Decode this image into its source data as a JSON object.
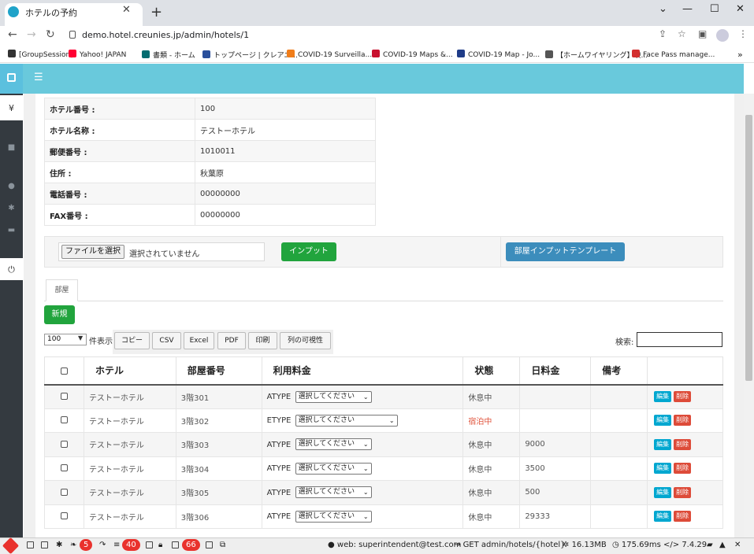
{
  "browser": {
    "tab_title": "ホテルの予約",
    "url": "demo.hotel.creunies.jp/admin/hotels/1",
    "bookmarks": [
      {
        "label": "[GroupSession]",
        "color": "#333333"
      },
      {
        "label": "Yahoo! JAPAN",
        "color": "#ff0033"
      },
      {
        "label": "書類 - ホーム",
        "color": "#036c70"
      },
      {
        "label": "トップページ | クレアニ...",
        "color": "#2a4f9b"
      },
      {
        "label": "COVID-19 Surveilla...",
        "color": "#f07d1a"
      },
      {
        "label": "COVID-19 Maps &...",
        "color": "#c8102e"
      },
      {
        "label": "COVID-19 Map - Jo...",
        "color": "#1f3c88"
      },
      {
        "label": "【ホームワイヤリング】映...",
        "color": "#555555"
      },
      {
        "label": "Face Pass manage...",
        "color": "#d32f2f"
      }
    ]
  },
  "hotel_info": [
    {
      "label": "ホテル番号 :",
      "value": "100"
    },
    {
      "label": "ホテル名称 :",
      "value": "テストーホテル"
    },
    {
      "label": "郵便番号 :",
      "value": "1010011"
    },
    {
      "label": "住所 :",
      "value": "秋葉原"
    },
    {
      "label": "電話番号 :",
      "value": "00000000"
    },
    {
      "label": "FAX番号 :",
      "value": "00000000"
    }
  ],
  "upload": {
    "file_button": "ファイルを選択",
    "file_status": "選択されていません",
    "input_button": "インプット",
    "template_button": "部屋インプットテンプレート"
  },
  "tabs": {
    "room": "部屋"
  },
  "new_button": "新規",
  "datatable": {
    "length_value": "100",
    "length_label": "件表示",
    "buttons": [
      "コピー",
      "CSV",
      "Excel",
      "PDF",
      "印刷",
      "列の可視性"
    ],
    "search_label": "検索:",
    "columns": [
      "ホテル",
      "部屋番号",
      "利用料金",
      "状態",
      "日料金",
      "備考"
    ],
    "rows": [
      {
        "hotel": "テストーホテル",
        "room": "3階301",
        "fee_type": "ATYPE",
        "fee_select": "選択してください",
        "status": "休息中",
        "day_fee": "",
        "note": ""
      },
      {
        "hotel": "テストーホテル",
        "room": "3階302",
        "fee_type": "ETYPE",
        "fee_select": "選択してください",
        "status": "宿泊中",
        "day_fee": "",
        "note": ""
      },
      {
        "hotel": "テストーホテル",
        "room": "3階303",
        "fee_type": "ATYPE",
        "fee_select": "選択してください",
        "status": "休息中",
        "day_fee": "9000",
        "note": ""
      },
      {
        "hotel": "テストーホテル",
        "room": "3階304",
        "fee_type": "ATYPE",
        "fee_select": "選択してください",
        "status": "休息中",
        "day_fee": "3500",
        "note": ""
      },
      {
        "hotel": "テストーホテル",
        "room": "3階305",
        "fee_type": "ATYPE",
        "fee_select": "選択してください",
        "status": "休息中",
        "day_fee": "500",
        "note": ""
      },
      {
        "hotel": "テストーホテル",
        "room": "3階306",
        "fee_type": "ATYPE",
        "fee_select": "選択してください",
        "status": "休息中",
        "day_fee": "29333",
        "note": ""
      }
    ],
    "edit_label": "編集",
    "delete_label": "削除"
  },
  "debugbar": {
    "badge_1": "5",
    "badge_2": "40",
    "badge_3": "66",
    "user": "web: superintendent@test.com",
    "route": "GET admin/hotels/{hotel}",
    "memory": "16.13MB",
    "time": "175.69ms",
    "php": "7.4.29"
  },
  "colors": {
    "header": "#69c9dc",
    "success": "#21a43d",
    "primary": "#3c8dbc",
    "danger": "#dd4b39",
    "info": "#00a7d0"
  }
}
